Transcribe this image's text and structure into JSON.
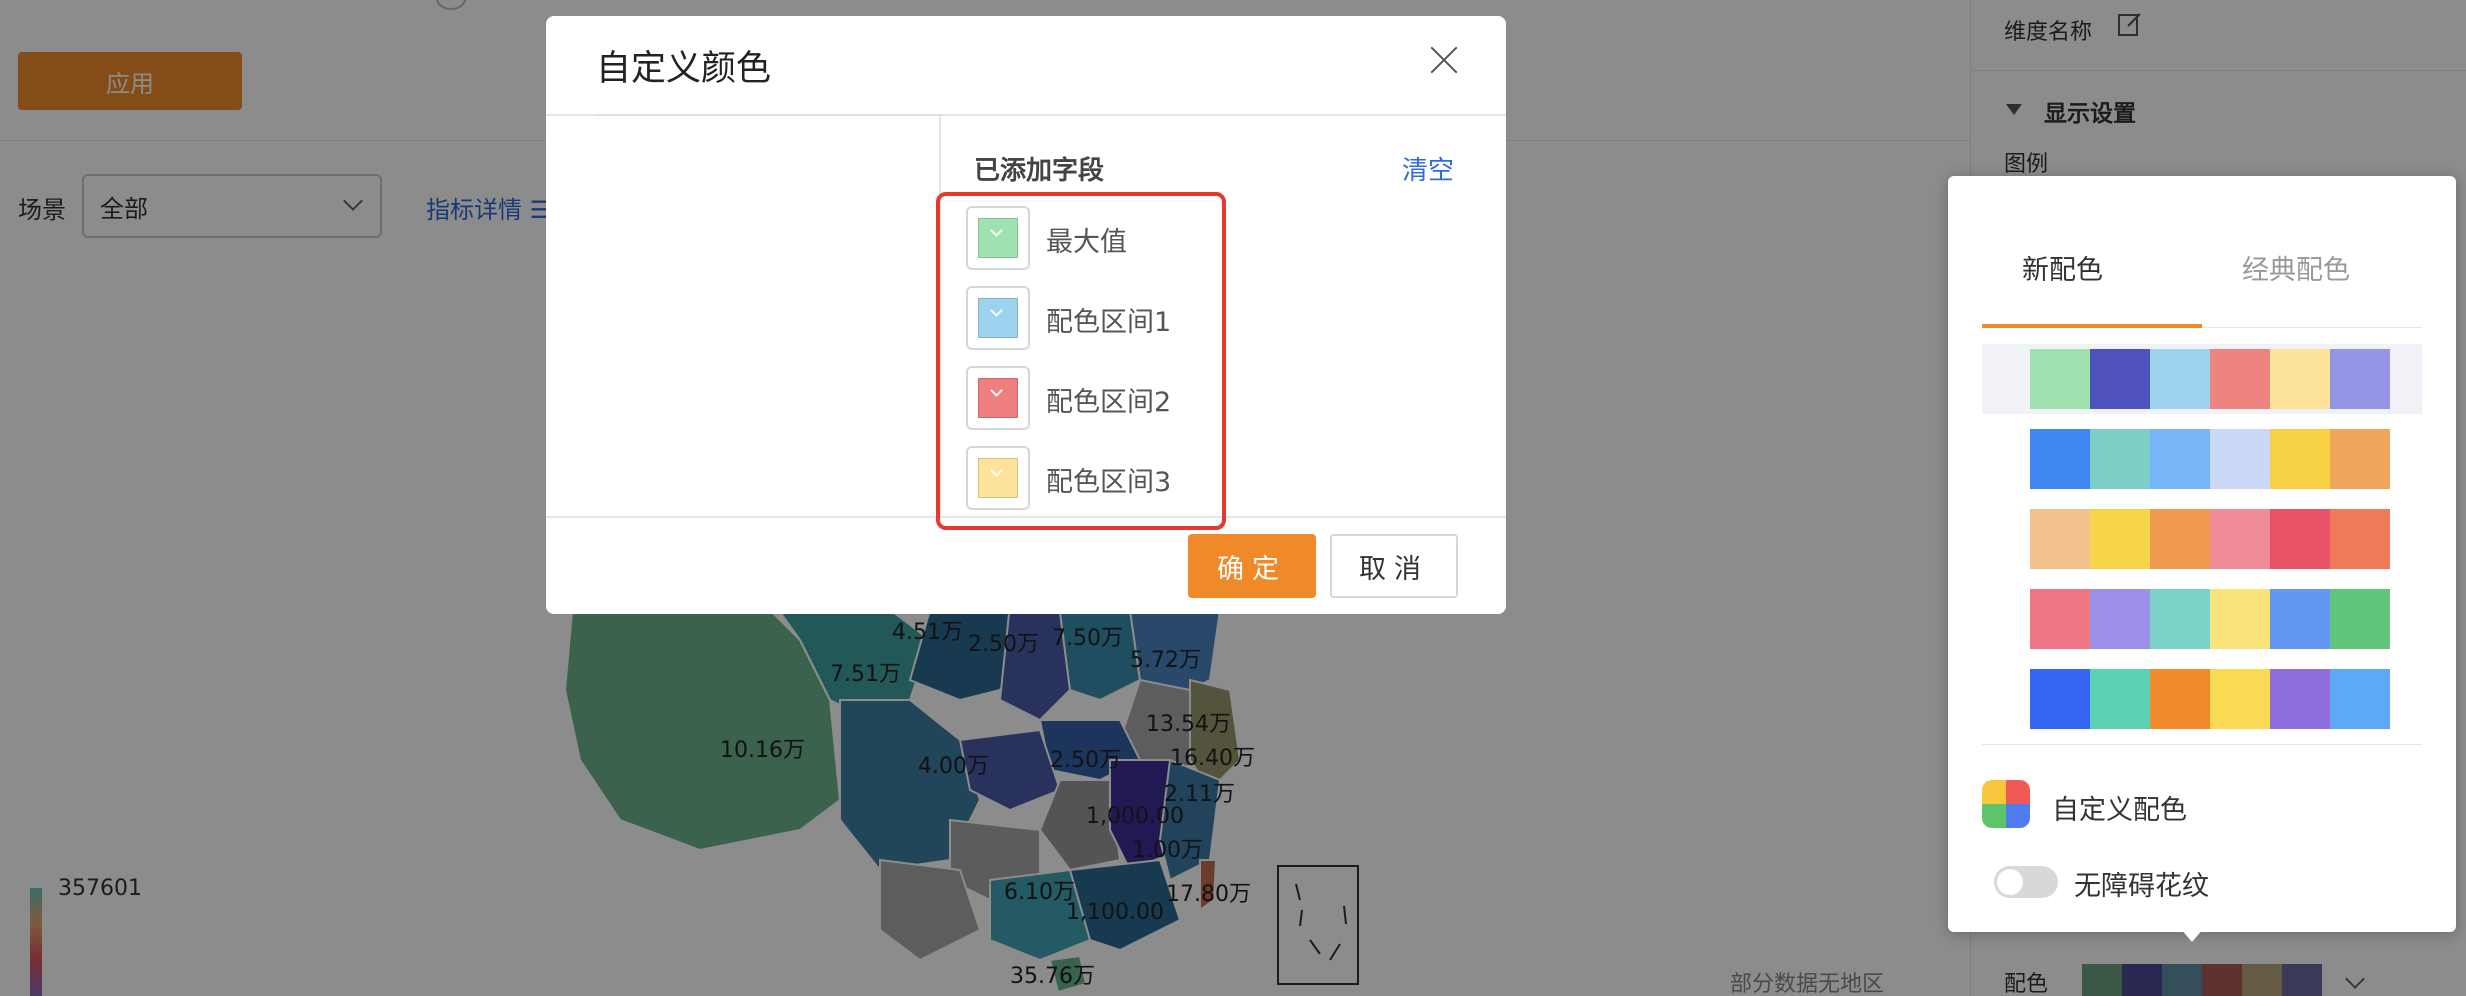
{
  "background": {
    "apply_label": "应用",
    "scene_label": "场景",
    "scene_value": "全部",
    "metric_link": "指标详情 ☰",
    "map_labels": [
      {
        "text": "4.51万"
      },
      {
        "text": "2.50万"
      },
      {
        "text": "7.50万"
      },
      {
        "text": "5.72万"
      },
      {
        "text": "7.51万"
      },
      {
        "text": "13.54万"
      },
      {
        "text": "10.16万"
      },
      {
        "text": "16.40万"
      },
      {
        "text": "4.00万"
      },
      {
        "text": "2.50万"
      },
      {
        "text": "2.11万"
      },
      {
        "text": "1,000.00"
      },
      {
        "text": "1.00万"
      },
      {
        "text": "6.10万"
      },
      {
        "text": "17.80万"
      },
      {
        "text": "1,100.00"
      },
      {
        "text": "35.76万"
      }
    ],
    "legend_max": "357601",
    "no_region_text": "部分数据无地区"
  },
  "right_panel": {
    "dimension_name": "维度名称",
    "display_settings": "显示设置",
    "legend_label": "图例",
    "color_label": "配色",
    "color_strip": [
      "#6aa07f",
      "#4b4a98",
      "#5f8ea6",
      "#ae5b5b",
      "#b8a47a",
      "#6e6aa2"
    ]
  },
  "modal": {
    "title": "自定义颜色",
    "added_fields_title": "已添加字段",
    "clear_label": "清空",
    "fields": [
      {
        "label": "最大值",
        "color": "#9fe2b0"
      },
      {
        "label": "配色区间1",
        "color": "#9dd3ee"
      },
      {
        "label": "配色区间2",
        "color": "#ee7f7e"
      },
      {
        "label": "配色区间3",
        "color": "#fde39a"
      }
    ],
    "ok_label": "确定",
    "cancel_label": "取消"
  },
  "popover": {
    "tabs": [
      {
        "label": "新配色",
        "active": true
      },
      {
        "label": "经典配色",
        "active": false
      }
    ],
    "palettes": [
      {
        "selected": true,
        "colors": [
          "#9fe2b0",
          "#4f52bd",
          "#9ed3ee",
          "#ee8380",
          "#fde29a",
          "#9595e6"
        ]
      },
      {
        "selected": false,
        "colors": [
          "#3f88f2",
          "#7ecec8",
          "#76b6f7",
          "#cbd8f8",
          "#f7d245",
          "#f0a65c"
        ]
      },
      {
        "selected": false,
        "colors": [
          "#f3c28e",
          "#f8d448",
          "#ef9a4e",
          "#ef8c98",
          "#e95368",
          "#ee7a58"
        ]
      },
      {
        "selected": false,
        "colors": [
          "#ef7785",
          "#9b8fe7",
          "#7ed3c8",
          "#fbe37c",
          "#6497f2",
          "#61c47b"
        ]
      },
      {
        "selected": false,
        "colors": [
          "#3466f2",
          "#5dd1b3",
          "#f08a2a",
          "#f9da55",
          "#8f6ede",
          "#5ea9f6"
        ]
      }
    ],
    "custom_label": "自定义配色",
    "accessibility_label": "无障碍花纹",
    "accessibility_on": false
  }
}
